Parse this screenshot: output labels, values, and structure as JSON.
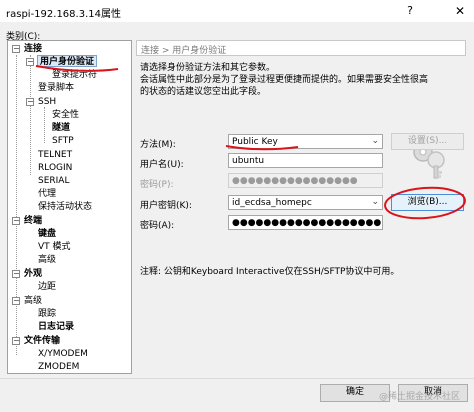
{
  "window": {
    "title": "raspi-192.168.3.14属性",
    "help_icon": "?",
    "close_icon": "✕"
  },
  "category_label": "类别(C):",
  "tree": {
    "connection": "连接",
    "user_auth": "用户身份验证",
    "login_prompt": "登录提示符",
    "login_script": "登录脚本",
    "ssh": "SSH",
    "security": "安全性",
    "tunnel": "隧道",
    "sftp": "SFTP",
    "telnet": "TELNET",
    "rlogin": "RLOGIN",
    "serial": "SERIAL",
    "proxy": "代理",
    "keepalive": "保持活动状态",
    "terminal": "终端",
    "keyboard": "键盘",
    "vt_mode": "VT 模式",
    "advanced_term": "高级",
    "appearance": "外观",
    "margin": "边距",
    "advanced": "高级",
    "trace": "跟踪",
    "log": "日志记录",
    "file_transfer": "文件传输",
    "xymodem": "X/YMODEM",
    "zmodem": "ZMODEM"
  },
  "panel": {
    "header": "连接 > 用户身份验证",
    "desc_line1": "请选择身份验证方法和其它参数。",
    "desc_line2": "会话属性中此部分是为了登录过程更便捷而提供的。如果需要安全性很高",
    "desc_line3": "的状态的话建议您空出此字段。"
  },
  "form": {
    "method_label": "方法(M):",
    "method_value": "Public Key",
    "settings_button": "设置(S)...",
    "username_label": "用户名(U):",
    "username_value": "ubuntu",
    "password_label_top": "密码(P):",
    "password_value_top": "●●●●●●●●●●●●●●●●",
    "userkey_label": "用户密钥(K):",
    "userkey_value": "id_ecdsa_homepc",
    "browse_button": "浏览(B)...",
    "passphrase_label": "密码(A):",
    "passphrase_value": "●●●●●●●●●●●●●●●●●●●"
  },
  "note": "注释: 公钥和Keyboard Interactive仅在SSH/SFTP协议中可用。",
  "footer": {
    "ok": "确定",
    "cancel": "取消"
  },
  "watermark": "@稀土掘金技术社区",
  "annotation_color": "#d9141c"
}
